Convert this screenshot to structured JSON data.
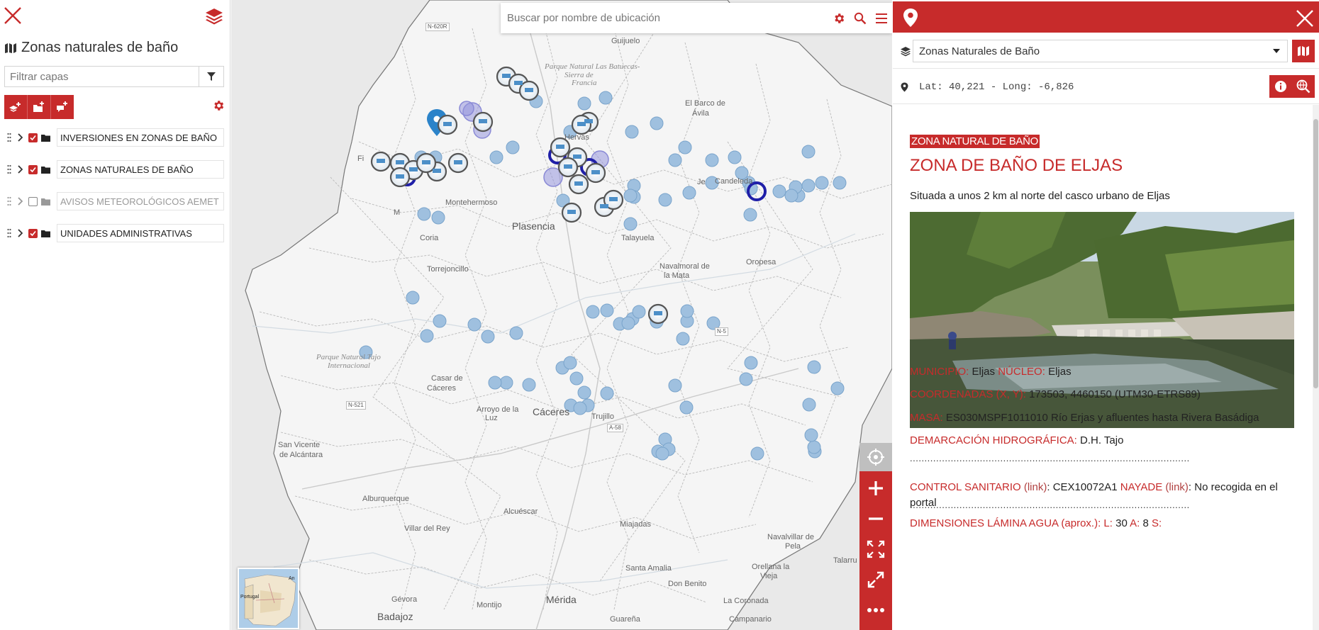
{
  "left_panel": {
    "title": "Zonas naturales de baño",
    "filter_placeholder": "Filtrar capas",
    "layers": [
      {
        "label": "INVERSIONES EN ZONAS DE BAÑO",
        "checked": true
      },
      {
        "label": "ZONAS NATURALES DE BAÑO",
        "checked": true
      },
      {
        "label": "AVISOS METEOROLÓGICOS AEMET",
        "checked": false
      },
      {
        "label": "UNIDADES ADMINISTRATIVAS",
        "checked": true
      }
    ]
  },
  "map": {
    "search_placeholder": "Buscar por nombre de ubicación",
    "places": {
      "guijuelo": "Guijuelo",
      "el_barco": "El Barco de",
      "avila": "Ávila",
      "hervas": "Hervás",
      "candeleda": "Candeleda",
      "montehermoso": "Montehermoso",
      "plasencia": "Plasencia",
      "coria": "Coria",
      "talayuela": "Talayuela",
      "navalmoral": "Navalmoral de",
      "la_mata": "la Mata",
      "oropesa": "Oropesa",
      "torrejoncillo": "Torrejoncillo",
      "casar": "Casar de",
      "caceres_small": "Cáceres",
      "caceres": "Cáceres",
      "arroyo": "Arroyo de la",
      "luz": "Luz",
      "trujillo": "Trujillo",
      "san_vicente": "San Vicente",
      "de_alcantara": "de Alcántara",
      "alburquerque": "Alburquerque",
      "alcuescar": "Alcuéscar",
      "villar_del_rey": "Villar del Rey",
      "miajadas": "Miajadas",
      "navalvillar": "Navalvillar de",
      "pela": "Pela",
      "talarrubias": "Talarru",
      "santa_amalia": "Santa Amalia",
      "don_benito": "Don Benito",
      "orellana": "Orellana la",
      "vieja": "Vieja",
      "gevora": "Gévora",
      "merida": "Mérida",
      "la_coronada": "La Coronada",
      "montijo": "Montijo",
      "badajoz": "Badajoz",
      "guarena": "Guareña",
      "campanario": "Campanario",
      "fi": "Fi",
      "m": "M",
      "je": "Je"
    },
    "parks": {
      "batuecas_1": "Parque Natural Las Batuecas-",
      "batuecas_2": "Sierra de",
      "batuecas_3": "Francia",
      "tajo_1": "Parque Natural Tajo",
      "tajo_2": "Internacional"
    },
    "roads": [
      "N-620R",
      "N-521",
      "A-58",
      "N-5"
    ],
    "minimap_labels": {
      "portugal": "Portugal",
      "an": "An"
    }
  },
  "right_panel": {
    "layer_select_value": "Zonas Naturales de Baño",
    "coords": "Lat: 40,221 - Long: -6,826",
    "zone_type": "ZONA NATURAL DE BAÑO",
    "zone_name": "ZONA DE BAÑO DE ELJAS",
    "description": "Situada a unos 2 km al norte del casco urbano de Eljas",
    "municipio_label": "MUNICIPIO:",
    "municipio": "Eljas",
    "nucleo_label": "NÚCLEO:",
    "nucleo": "Eljas",
    "coordenadas_label": "COORDENADAS (X, Y):",
    "coordenadas": "173503, 4460150 (UTM30-ETRS89)",
    "masa_label": "MASA:",
    "masa": "ES030MSPF1011010 Río Erjas y afluentes hasta Rivera Basádiga",
    "demarcacion_label": "DEMARCACIÓN HIDROGRÁFICA:",
    "demarcacion": "D.H. Tajo",
    "separator": "................................................................................................",
    "control_label": "CONTROL SANITARIO",
    "control_link": "(link)",
    "control_value": "CEX10072A1",
    "nayade_label": "NAYADE",
    "nayade_link": "(link)",
    "nayade_value": "No recogida en el portal",
    "dimensiones_label": "DIMENSIONES LÁMINA AGUA (aprox.):",
    "l_label": "L:",
    "l_value": "30",
    "a_label": "A:",
    "a_value": "8",
    "s_label": "S:"
  },
  "colors": {
    "accent": "#c72b2b",
    "map_bg": "#e9e9e9",
    "land": "#f4f4f4"
  }
}
